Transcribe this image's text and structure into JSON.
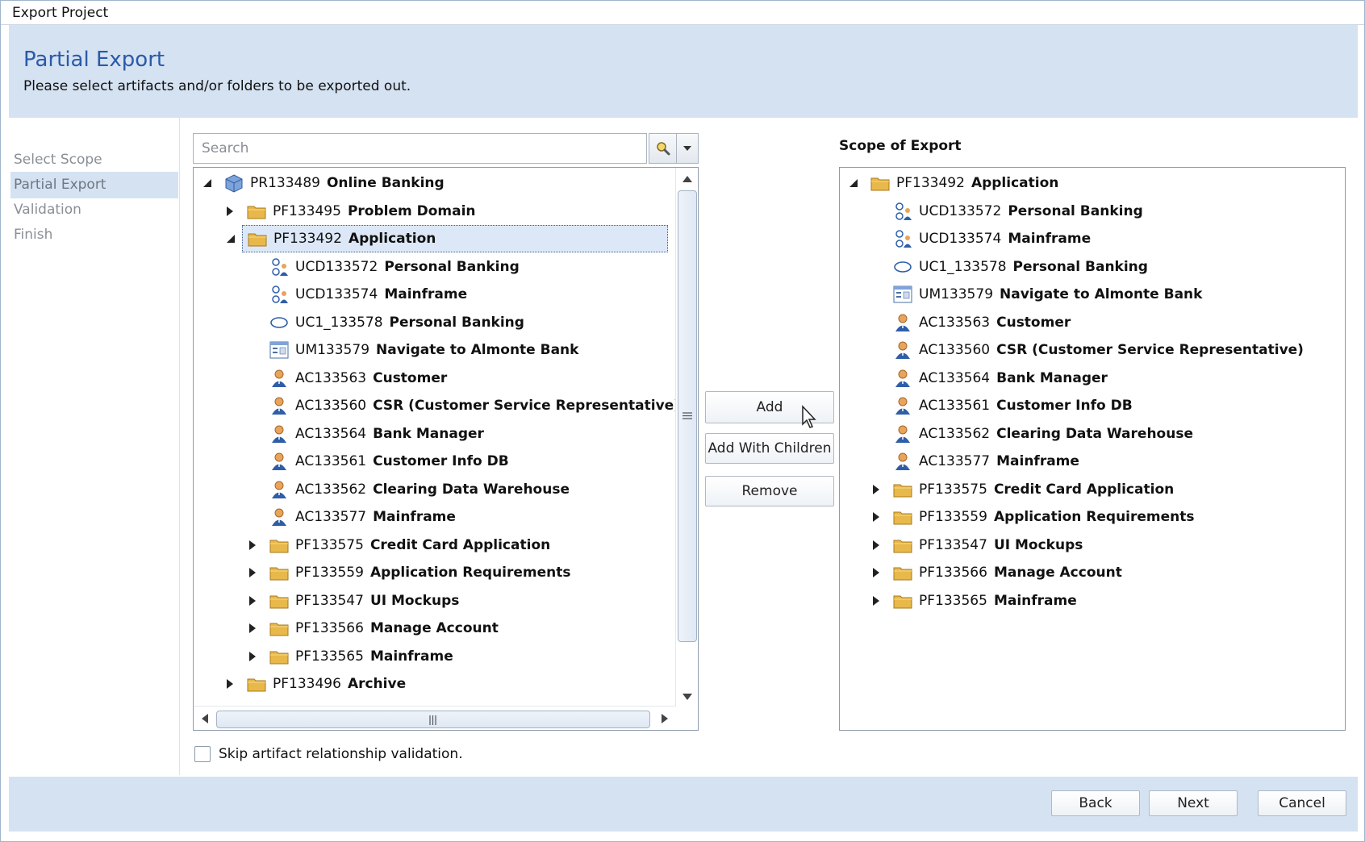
{
  "window": {
    "title": "Export Project"
  },
  "header": {
    "title": "Partial Export",
    "subtitle": "Please select artifacts and/or folders to be exported out."
  },
  "steps": [
    "Select Scope",
    "Partial Export",
    "Validation",
    "Finish"
  ],
  "search": {
    "placeholder": "Search",
    "value": ""
  },
  "left_tree": [
    {
      "code": "PR133489",
      "name": "Online Banking",
      "icon": "project-cube-icon",
      "toggle": "expanded"
    },
    {
      "code": "PF133495",
      "name": "Problem Domain",
      "icon": "folder-icon",
      "toggle": "collapsed"
    },
    {
      "code": "PF133492",
      "name": "Application",
      "icon": "folder-icon",
      "toggle": "expanded",
      "selected": true
    },
    {
      "code": "UCD133572",
      "name": "Personal Banking",
      "icon": "use-case-diagram-icon"
    },
    {
      "code": "UCD133574",
      "name": "Mainframe",
      "icon": "use-case-diagram-icon"
    },
    {
      "code": "UC1_133578",
      "name": "Personal Banking",
      "icon": "use-case-ellipse-icon"
    },
    {
      "code": "UM133579",
      "name": "Navigate to Almonte Bank",
      "icon": "ui-mockup-icon"
    },
    {
      "code": "AC133563",
      "name": "Customer",
      "icon": "actor-icon"
    },
    {
      "code": "AC133560",
      "name": "CSR (Customer Service Representative)",
      "icon": "actor-icon"
    },
    {
      "code": "AC133564",
      "name": "Bank Manager",
      "icon": "actor-icon"
    },
    {
      "code": "AC133561",
      "name": "Customer Info DB",
      "icon": "actor-icon"
    },
    {
      "code": "AC133562",
      "name": "Clearing Data Warehouse",
      "icon": "actor-icon"
    },
    {
      "code": "AC133577",
      "name": "Mainframe",
      "icon": "actor-icon"
    },
    {
      "code": "PF133575",
      "name": "Credit Card Application",
      "icon": "folder-icon",
      "toggle": "collapsed"
    },
    {
      "code": "PF133559",
      "name": "Application Requirements",
      "icon": "folder-icon",
      "toggle": "collapsed"
    },
    {
      "code": "PF133547",
      "name": "UI Mockups",
      "icon": "folder-icon",
      "toggle": "collapsed"
    },
    {
      "code": "PF133566",
      "name": "Manage Account",
      "icon": "folder-icon",
      "toggle": "collapsed"
    },
    {
      "code": "PF133565",
      "name": "Mainframe",
      "icon": "folder-icon",
      "toggle": "collapsed"
    },
    {
      "code": "PF133496",
      "name": "Archive",
      "icon": "folder-icon",
      "toggle": "collapsed"
    }
  ],
  "buttons": {
    "add": "Add",
    "add_children": "Add With Children",
    "remove": "Remove"
  },
  "scope": {
    "title": "Scope of Export",
    "items": [
      {
        "code": "PF133492",
        "name": "Application",
        "icon": "folder-icon",
        "toggle": "expanded"
      },
      {
        "code": "UCD133572",
        "name": "Personal Banking",
        "icon": "use-case-diagram-icon"
      },
      {
        "code": "UCD133574",
        "name": "Mainframe",
        "icon": "use-case-diagram-icon"
      },
      {
        "code": "UC1_133578",
        "name": "Personal Banking",
        "icon": "use-case-ellipse-icon"
      },
      {
        "code": "UM133579",
        "name": "Navigate to Almonte Bank",
        "icon": "ui-mockup-icon"
      },
      {
        "code": "AC133563",
        "name": "Customer",
        "icon": "actor-icon"
      },
      {
        "code": "AC133560",
        "name": "CSR (Customer Service Representative)",
        "icon": "actor-icon"
      },
      {
        "code": "AC133564",
        "name": "Bank Manager",
        "icon": "actor-icon"
      },
      {
        "code": "AC133561",
        "name": "Customer Info DB",
        "icon": "actor-icon"
      },
      {
        "code": "AC133562",
        "name": "Clearing Data Warehouse",
        "icon": "actor-icon"
      },
      {
        "code": "AC133577",
        "name": "Mainframe",
        "icon": "actor-icon"
      },
      {
        "code": "PF133575",
        "name": "Credit Card Application",
        "icon": "folder-icon",
        "toggle": "collapsed"
      },
      {
        "code": "PF133559",
        "name": "Application Requirements",
        "icon": "folder-icon",
        "toggle": "collapsed"
      },
      {
        "code": "PF133547",
        "name": "UI Mockups",
        "icon": "folder-icon",
        "toggle": "collapsed"
      },
      {
        "code": "PF133566",
        "name": "Manage Account",
        "icon": "folder-icon",
        "toggle": "collapsed"
      },
      {
        "code": "PF133565",
        "name": "Mainframe",
        "icon": "folder-icon",
        "toggle": "collapsed"
      }
    ]
  },
  "skip_validation": {
    "label": "Skip artifact relationship validation.",
    "checked": false
  },
  "footer": {
    "back": "Back",
    "next": "Next",
    "cancel": "Cancel"
  },
  "colors": {
    "accent": "#2a5aa8",
    "header_bg": "#d5e2f2",
    "selection_bg": "#dce8f7",
    "folder": "#e8b84a",
    "actor": "#2f5ea8"
  }
}
